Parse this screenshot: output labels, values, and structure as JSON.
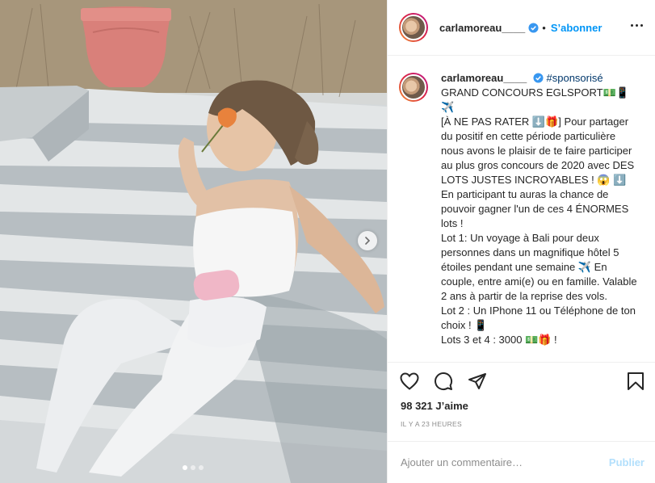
{
  "post": {
    "username": "carlamoreau____",
    "follow_label": "S’abonner",
    "separator": "•"
  },
  "caption": {
    "username": "carlamoreau____",
    "hashtag": "#sponsorisé",
    "lines": [
      "GRAND CONCOURS EGLSPORT💵📱",
      "✈️",
      "[À NE PAS RATER ⬇️🎁] Pour partager du positif en cette période particulière nous avons le plaisir de te faire participer au plus gros concours de 2020 avec DES LOTS JUSTES INCROYABLES ! 😱 ⬇️ En participant tu auras la chance de pouvoir gagner l'un de ces 4 ÉNORMES lots !",
      "Lot 1: Un voyage à Bali pour deux personnes dans un magnifique hôtel 5 étoiles pendant une semaine ✈️ En couple, entre ami(e) ou en famille. Valable 2 ans à partir de la reprise des vols.",
      "Lot 2 : Un IPhone 11 ou Téléphone de ton choix ! 📱",
      "Lots 3 et 4 : 3000 💵🎁 !"
    ]
  },
  "stats": {
    "likes_count": "98 321",
    "likes_word": "J’aime",
    "time_ago": "IL Y A 23 HEURES"
  },
  "comment": {
    "placeholder": "Ajouter un commentaire…",
    "publish_label": "Publier"
  },
  "carousel": {
    "slide_count": 3,
    "active_index": 0
  },
  "colors": {
    "accent": "#0095f6",
    "publish_disabled": "#b2dffc",
    "text": "#262626",
    "muted": "#8e8e8e",
    "border": "#efefef"
  },
  "icons": [
    "heart-icon",
    "comment-icon",
    "share-icon",
    "bookmark-icon",
    "more-options-icon",
    "verified-badge-icon",
    "chevron-right-icon"
  ]
}
